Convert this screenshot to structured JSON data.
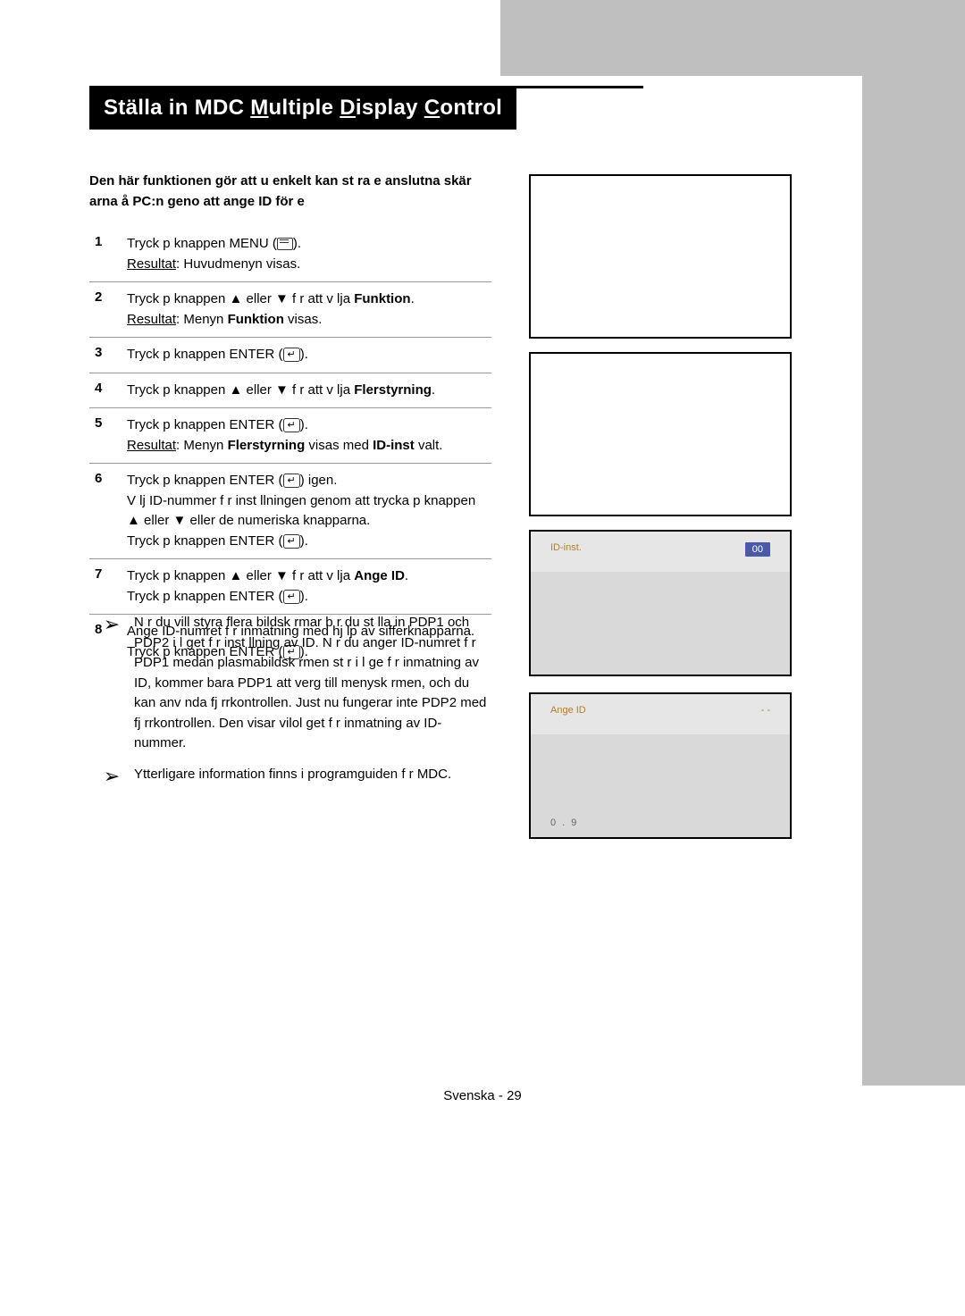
{
  "title": {
    "pre": "Ställa in MDC ",
    "m": "M",
    "mid1": "ultiple ",
    "d": "D",
    "mid2": "isplay ",
    "c": "C",
    "post": "ontrol"
  },
  "intro": "Den här funktionen gör att u enkelt kan st ra e anslutna skär arna å PC:n geno att ange ID för e",
  "steps": [
    {
      "num": "1",
      "lines": [
        {
          "text": "Tryck p knappen MENU (",
          "icon": "menu",
          "after": ")."
        },
        {
          "label": "Resultat",
          "text": ": Huvudmenyn visas."
        }
      ]
    },
    {
      "num": "2",
      "lines": [
        {
          "text": "Tryck p knappen ▲ eller ▼ f r att v lja ",
          "bold": "Funktion",
          "after": "."
        },
        {
          "label": "Resultat",
          "text": ": Menyn ",
          "bold": "Funktion",
          "after": " visas."
        }
      ]
    },
    {
      "num": "3",
      "lines": [
        {
          "text": "Tryck p knappen ENTER (",
          "icon": "enter",
          "after": ")."
        }
      ]
    },
    {
      "num": "4",
      "lines": [
        {
          "text": "Tryck p knappen ▲ eller ▼ f r att v lja ",
          "bold": "Flerstyrning",
          "after": "."
        }
      ]
    },
    {
      "num": "5",
      "lines": [
        {
          "text": "Tryck p knappen ENTER (",
          "icon": "enter",
          "after": ")."
        },
        {
          "label": "Resultat",
          "text": ": Menyn ",
          "bold": "Flerstyrning",
          "after": " visas med ",
          "bold2": "ID-inst",
          "after2": " valt."
        }
      ]
    },
    {
      "num": "6",
      "lines": [
        {
          "text": "Tryck p knappen ENTER (",
          "icon": "enter",
          "after": ") igen."
        },
        {
          "text": "V lj ID-nummer f r inst llningen genom att trycka p knappen ▲ eller ▼ eller de numeriska knapparna."
        },
        {
          "text": "Tryck p knappen ENTER (",
          "icon": "enter",
          "after": ")."
        }
      ]
    },
    {
      "num": "7",
      "lines": [
        {
          "text": "Tryck p knappen ▲ eller ▼ f r att v lja ",
          "bold": "Ange ID",
          "after": "."
        },
        {
          "text": "Tryck p knappen ENTER (",
          "icon": "enter",
          "after": ")."
        }
      ]
    },
    {
      "num": "8",
      "lines": [
        {
          "text": "Ange ID-numret f r inmatning med hj lp av sifferknapparna."
        },
        {
          "text": "Tryck p knappen ENTER (",
          "icon": "enter",
          "after": ")."
        }
      ]
    }
  ],
  "notes": [
    {
      "sym": "➢",
      "text": "N r du vill styra flera bildsk rmar b r du st lla in PDP1 och PDP2 i l get f r inst llning av ID. N r du anger ID-numret f r PDP1 medan plasmabildsk rmen st r i l ge f r inmatning av ID, kommer bara PDP1 att verg till menysk rmen, och du kan anv nda fj rrkontrollen. Just nu fungerar inte PDP2 med fj rrkontrollen. Den visar vilol get f r inmatning av ID-nummer."
    },
    {
      "sym": "➢",
      "text": "Ytterligare information finns i programguiden f r MDC."
    }
  ],
  "osd3": {
    "label": "ID-inst.",
    "value": "00"
  },
  "osd4": {
    "label": "Ange ID",
    "value": "- -",
    "bottom": "0 . 9"
  },
  "footer": "Svenska - 29"
}
